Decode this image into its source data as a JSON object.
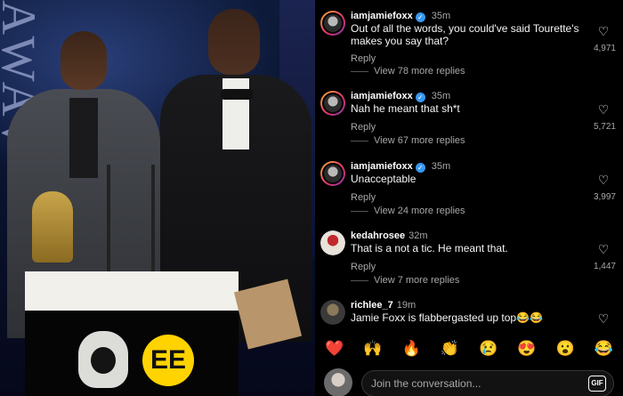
{
  "photo": {
    "backdrop_text": "AWAV",
    "ee_logo": "EE"
  },
  "comments": [
    {
      "username": "iamjamiefoxx",
      "verified": true,
      "time": "35m",
      "text": "Out of all the words, you could've said Tourette's makes you say that?",
      "reply_label": "Reply",
      "view_replies": "View 78 more replies",
      "likes": "4,971",
      "avatar": "story-avatar"
    },
    {
      "username": "iamjamiefoxx",
      "verified": true,
      "time": "35m",
      "text": "Nah he meant that sh*t",
      "reply_label": "Reply",
      "view_replies": "View 67 more replies",
      "likes": "5,721",
      "avatar": "story-avatar"
    },
    {
      "username": "iamjamiefoxx",
      "verified": true,
      "time": "35m",
      "text": "Unacceptable",
      "reply_label": "Reply",
      "view_replies": "View 24 more replies",
      "likes": "3,997",
      "avatar": "story-avatar"
    },
    {
      "username": "kedahrosee",
      "verified": false,
      "time": "32m",
      "text": "That is a not a tic. He meant that.",
      "reply_label": "Reply",
      "view_replies": "View 7 more replies",
      "likes": "1,447",
      "avatar": "plain-avatar"
    },
    {
      "username": "richlee_7",
      "verified": false,
      "time": "19m",
      "text": "Jamie Foxx is flabbergasted up top😂😂",
      "avatar": "plain-avatar"
    }
  ],
  "emoji_bar": [
    "❤️",
    "🙌",
    "🔥",
    "👏",
    "😢",
    "😍",
    "😮",
    "😂"
  ],
  "input": {
    "placeholder": "Join the conversation...",
    "gif_label": "GIF"
  },
  "colors": {
    "background": "#000000",
    "secondary_text": "#a8a8a8",
    "verified_blue": "#3897f0"
  },
  "icons": {
    "like": "heart-outline-icon",
    "verified": "verified-badge-icon"
  }
}
